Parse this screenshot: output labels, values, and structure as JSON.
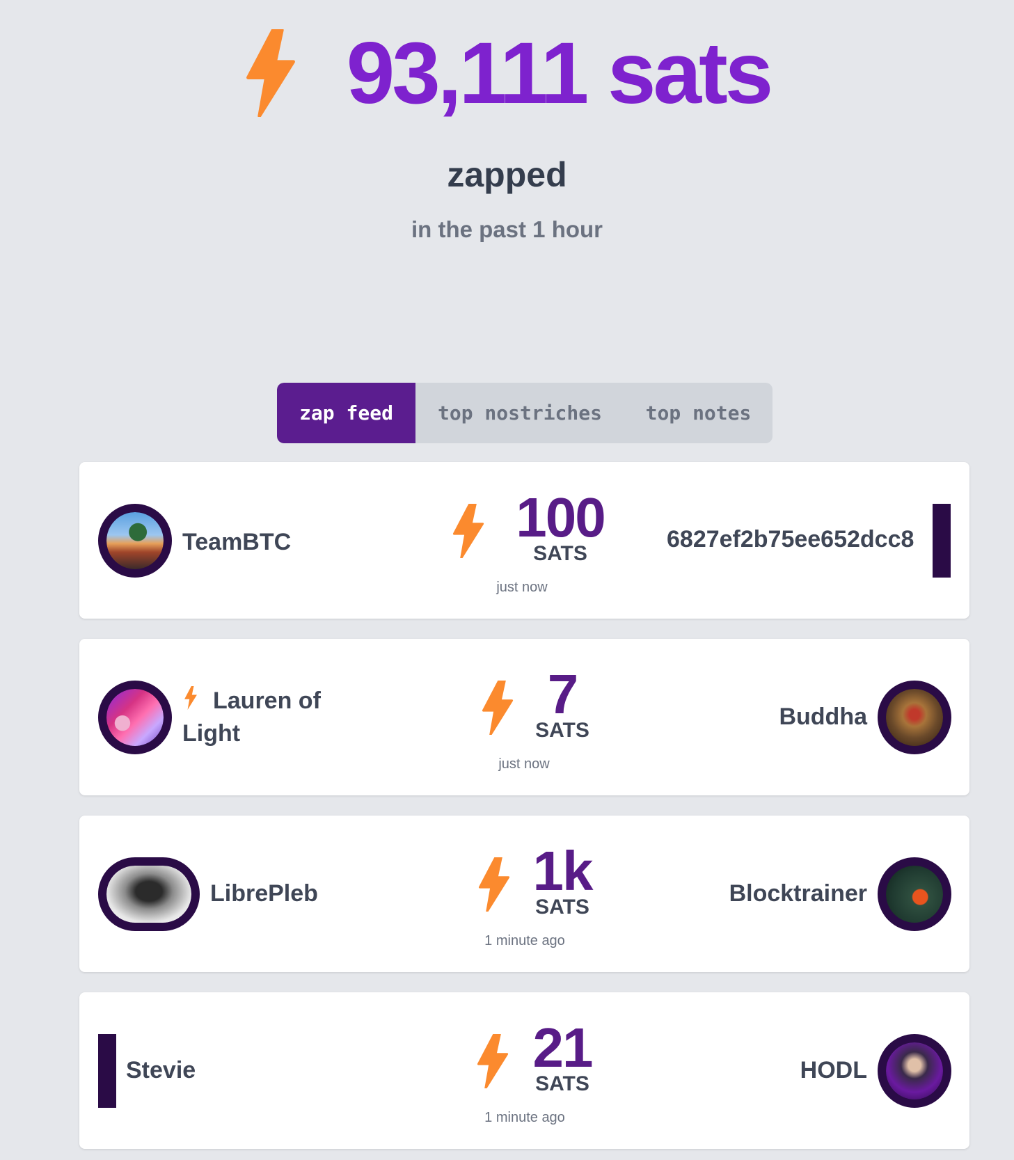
{
  "summary": {
    "total": "93,111 sats",
    "label": "zapped",
    "period": "in the past 1 hour"
  },
  "tabs": [
    {
      "label": "zap feed",
      "active": true
    },
    {
      "label": "top nostriches",
      "active": false
    },
    {
      "label": "top notes",
      "active": false
    }
  ],
  "feed": [
    {
      "sender": "TeamBTC",
      "amount": "100",
      "unit": "SATS",
      "time": "just now",
      "recipient": "6827ef2b75ee652dcc8"
    },
    {
      "sender": "Lauren of Light",
      "amount": "7",
      "unit": "SATS",
      "time": "just now",
      "recipient": "Buddha"
    },
    {
      "sender": "LibrePleb",
      "amount": "1k",
      "unit": "SATS",
      "time": "1 minute ago",
      "recipient": "Blocktrainer"
    },
    {
      "sender": "Stevie",
      "amount": "21",
      "unit": "SATS",
      "time": "1 minute ago",
      "recipient": "HODL"
    }
  ],
  "colors": {
    "accent": "#7e22ce",
    "accent_dark": "#581c87",
    "bolt": "#f97316",
    "avatar_ring": "#2a0b46",
    "background": "#e5e7eb"
  },
  "icons": {
    "zap": "lightning-bolt"
  }
}
